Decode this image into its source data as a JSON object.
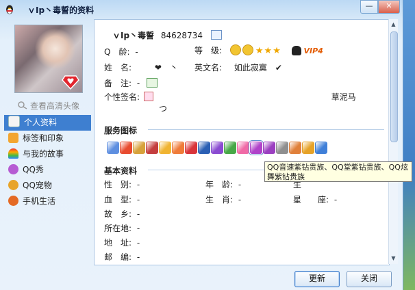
{
  "window": {
    "title": "ｖIp丶毒誓的资料",
    "min_label": "—",
    "close_label": "✕"
  },
  "sidebar": {
    "view_hd_label": "查看高清头像",
    "items": [
      {
        "label": "个人资料",
        "icon": "profile-card-icon",
        "color": "#f4f4f4",
        "active": true
      },
      {
        "label": "标签和印象",
        "icon": "tag-icon",
        "color": "#f3a531"
      },
      {
        "label": "与我的故事",
        "icon": "rainbow-icon",
        "color": "#6ab04c"
      },
      {
        "label": "QQ秀",
        "icon": "qq-show-icon",
        "color": "#b65bd3"
      },
      {
        "label": "QQ宠物",
        "icon": "qq-pet-icon",
        "color": "#e8a42a"
      },
      {
        "label": "手机生活",
        "icon": "mobile-life-icon",
        "color": "#e46a25"
      }
    ]
  },
  "profile": {
    "nickname": "ｖIp丶毒誓",
    "qq_number": "84628734",
    "age_label": "Q　龄:",
    "age_value": "-",
    "level_label": "等　级:",
    "vip_label": "VIP4",
    "name_label": "姓　名:",
    "name_value": "❤　丶",
    "english_name_label": "英文名:",
    "english_name_value": "如此寂寞　✔",
    "note_label": "备　注:",
    "note_value": "-",
    "signature_label": "个性签名:",
    "signature_value": "草泥马",
    "signature_extra": "つ"
  },
  "services": {
    "title": "服务图标",
    "icons": [
      {
        "name": "blue-diamond-icon",
        "color": "#5e8fe0"
      },
      {
        "name": "red-heart-badge-icon",
        "color": "#e84b2f"
      },
      {
        "name": "qq-pet-service-icon",
        "color": "#d7a23b"
      },
      {
        "name": "qq-show-service-icon",
        "color": "#c43e3e"
      },
      {
        "name": "yellow-diamond-icon",
        "color": "#f0b431"
      },
      {
        "name": "orange-diamond-icon",
        "color": "#ef7b39"
      },
      {
        "name": "red-diamond-heart-icon",
        "color": "#d9343a"
      },
      {
        "name": "nba-icon",
        "color": "#2b5fb4"
      },
      {
        "name": "purple-heart-diamond-icon",
        "color": "#8a4bd1"
      },
      {
        "name": "green-diamond-icon",
        "color": "#47a847"
      },
      {
        "name": "pink-diamond-icon",
        "color": "#f06aa6"
      },
      {
        "name": "purple-diamond-icon",
        "color": "#b042c9",
        "selected": true
      },
      {
        "name": "violet-diamond-icon",
        "color": "#9b3fc0"
      },
      {
        "name": "gray-diamond-icon",
        "color": "#8f8f8f"
      },
      {
        "name": "gift-icon",
        "color": "#e0803a"
      },
      {
        "name": "book-icon",
        "color": "#e6a227"
      },
      {
        "name": "phone-icon",
        "color": "#3f7fd8"
      }
    ],
    "tooltip": "QQ音速紫钻贵族、QQ堂紫钻贵族、QQ炫舞紫钻贵族"
  },
  "basic": {
    "title": "基本资料",
    "gender_label": "性　别:",
    "gender_value": "-",
    "age2_label": "年　龄:",
    "age2_value": "-",
    "birthday_label": "生",
    "blood_label": "血　型:",
    "blood_value": "-",
    "zodiac_label": "生　肖:",
    "zodiac_value": "-",
    "star_label": "星　　座:",
    "star_value": "-",
    "hometown_label": "故　乡:",
    "hometown_value": "-",
    "location_label": "所在地:",
    "location_value": "-",
    "address_label": "地　址:",
    "address_value": "-",
    "zipcode_label": "邮　编:",
    "zipcode_value": "-"
  },
  "footer": {
    "refresh_label": "更新",
    "close_label": "关闭"
  }
}
